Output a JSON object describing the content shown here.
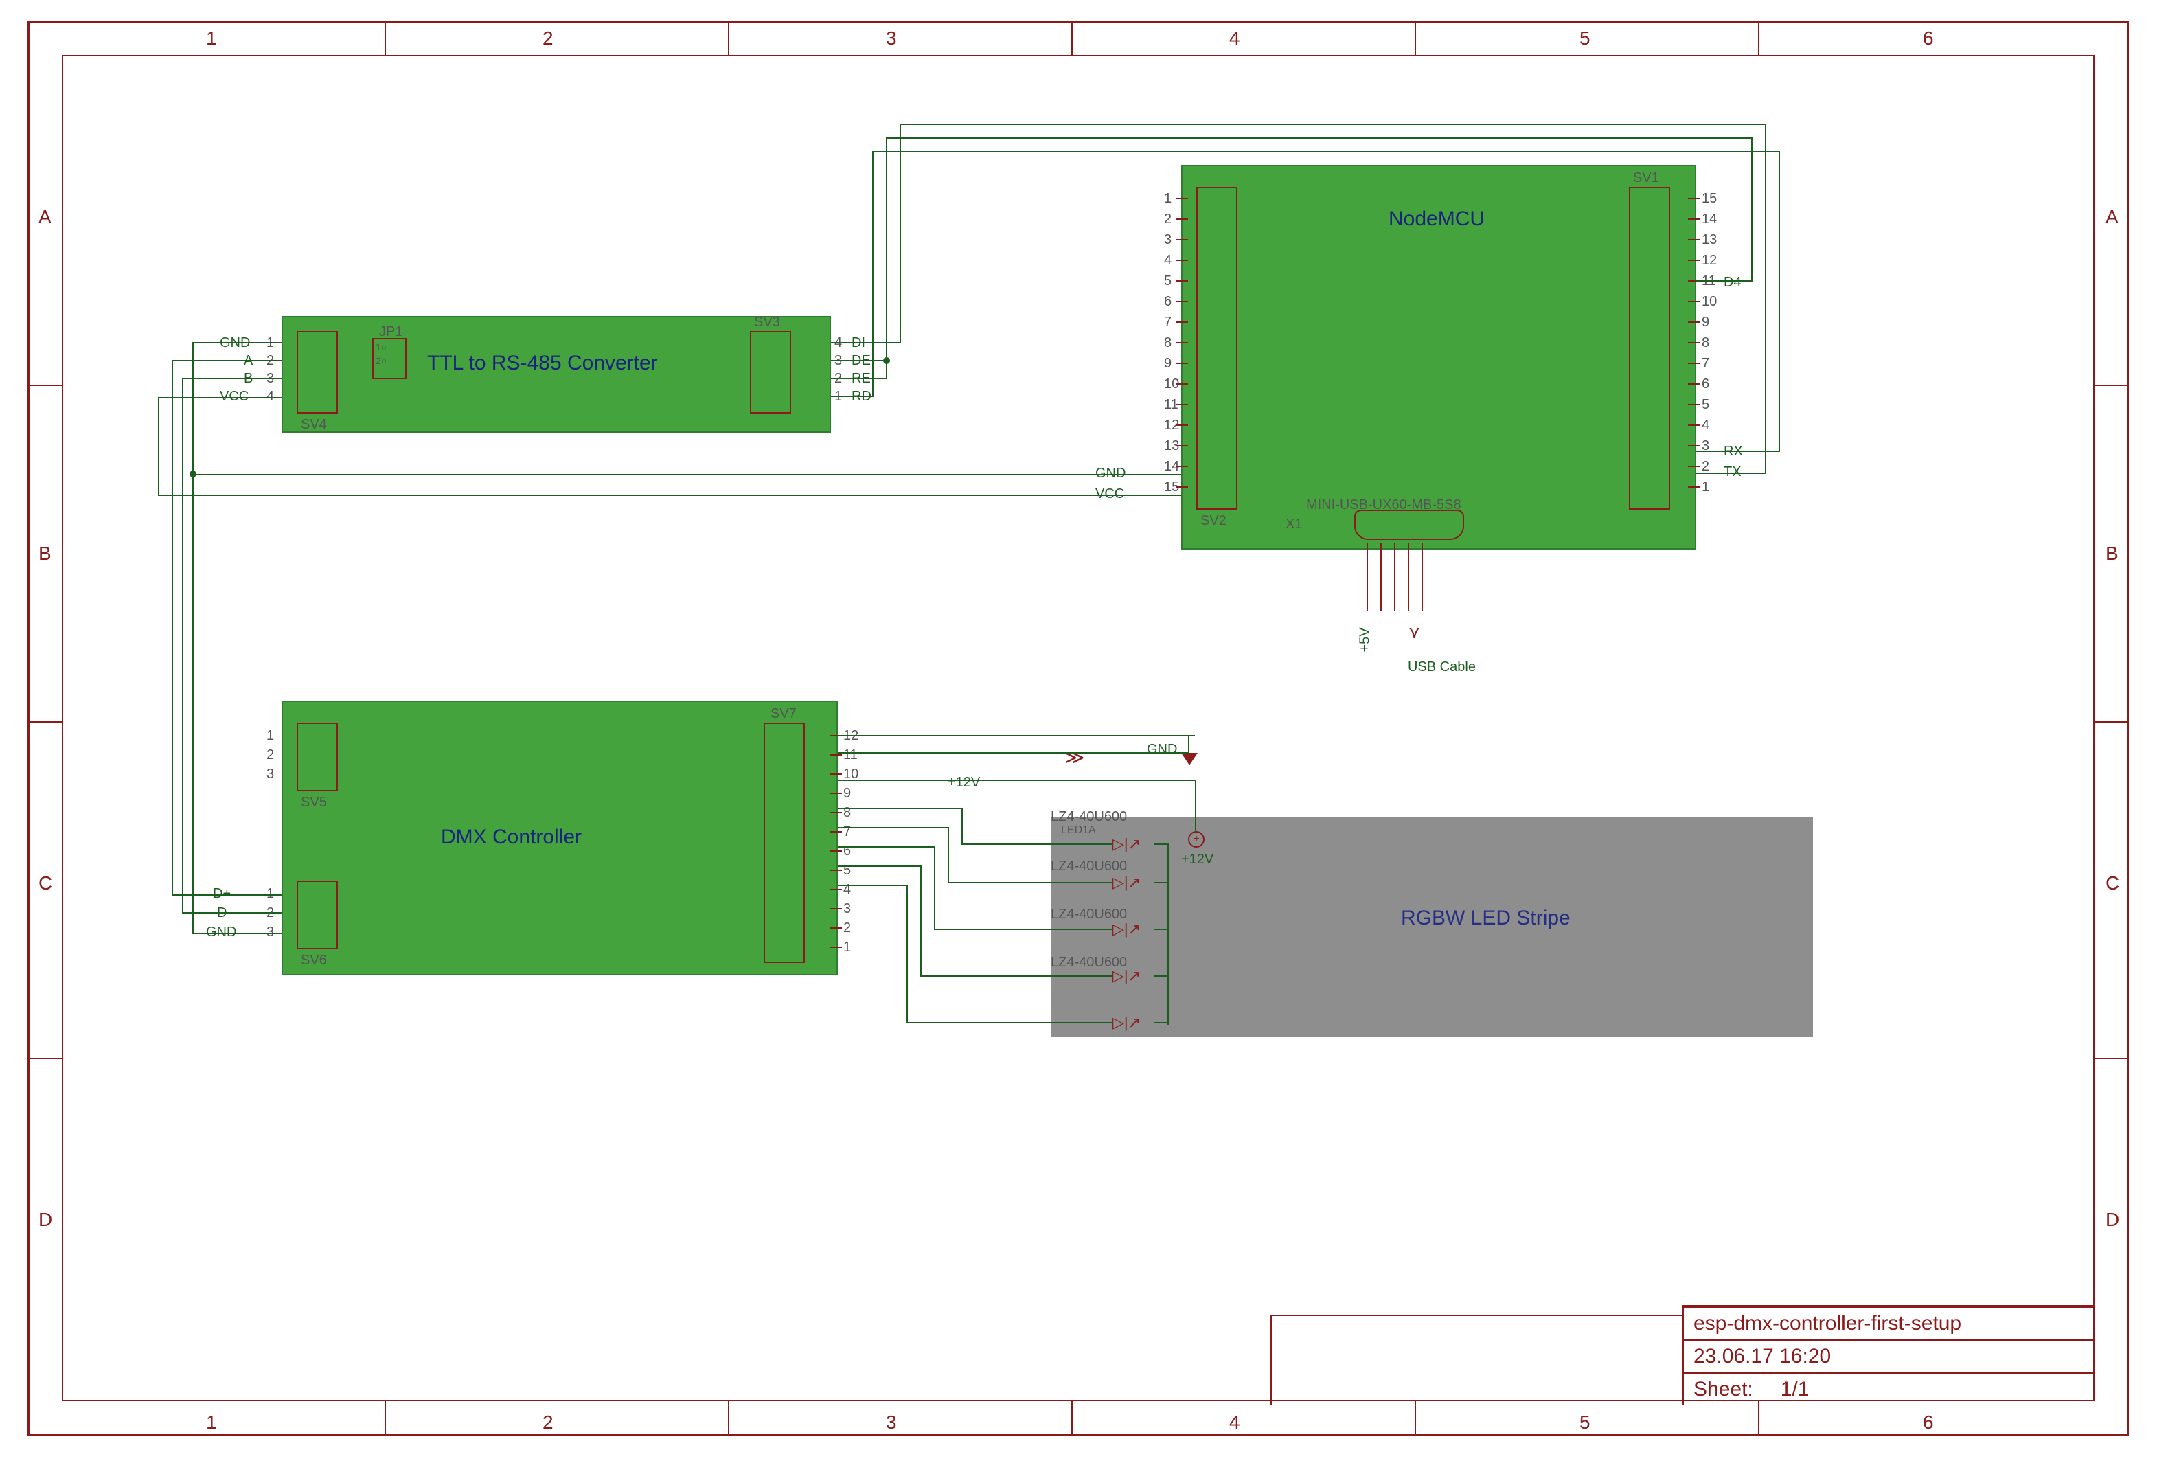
{
  "frame": {
    "cols": [
      "1",
      "2",
      "3",
      "4",
      "5",
      "6"
    ],
    "rows": [
      "A",
      "B",
      "C",
      "D"
    ]
  },
  "titleblock": {
    "project": "esp-dmx-controller-first-setup",
    "date": "23.06.17 16:20",
    "sheet_label": "Sheet:",
    "sheet_value": "1/1"
  },
  "blocks": {
    "ttl": {
      "label": "TTL to RS-485 Converter",
      "left_header_ref": "SV4",
      "right_header_ref": "SV3",
      "left_pins": [
        {
          "num": "1",
          "name": "GND"
        },
        {
          "num": "2",
          "name": "A"
        },
        {
          "num": "3",
          "name": "B"
        },
        {
          "num": "4",
          "name": "VCC"
        }
      ],
      "right_pins": [
        {
          "num": "4",
          "name": "DI"
        },
        {
          "num": "3",
          "name": "DE"
        },
        {
          "num": "2",
          "name": "RE"
        },
        {
          "num": "1",
          "name": "RD"
        }
      ],
      "jp": {
        "ref": "JP1",
        "opts": "1\n2"
      }
    },
    "nodemcu": {
      "label": "NodeMCU",
      "left_header_ref": "SV2",
      "right_header_ref": "SV1",
      "usb_label": "MINI-USB-UX60-MB-5S8",
      "usb_part_ref": "X1",
      "usb_cable_label": "USB Cable",
      "usb_plus5v": "+5V",
      "left_pins": [
        "1",
        "2",
        "3",
        "4",
        "5",
        "6",
        "7",
        "8",
        "9",
        "10",
        "11",
        "12",
        "13",
        "14",
        "15"
      ],
      "right_pins": [
        "15",
        "14",
        "13",
        "12",
        "11",
        "10",
        "9",
        "8",
        "7",
        "6",
        "5",
        "4",
        "3",
        "2",
        "1"
      ],
      "left_extra": [
        {
          "num": "14",
          "name": "GND"
        },
        {
          "num": "15",
          "name": "VCC"
        }
      ],
      "right_extra": [
        {
          "num": "11",
          "name": "D4"
        },
        {
          "num": "2",
          "name": "RX"
        },
        {
          "num": "1",
          "name": "TX"
        }
      ]
    },
    "dmx": {
      "label": "DMX Controller",
      "top_header_ref": "SV5",
      "bottom_header_ref": "SV6",
      "right_header_ref": "SV7",
      "top_pins": [
        "1",
        "2",
        "3"
      ],
      "bottom_pins": [
        {
          "num": "1",
          "name": "D+"
        },
        {
          "num": "2",
          "name": "D-"
        },
        {
          "num": "3",
          "name": "GND"
        }
      ],
      "right_pins": [
        "12",
        "11",
        "10",
        "9",
        "8",
        "7",
        "6",
        "5",
        "4",
        "3",
        "2",
        "1"
      ]
    },
    "rgbw": {
      "label": "RGBW LED Stripe",
      "plus12v_label": "+12V",
      "gnd_label": "GND",
      "led_part": "LZ4-40U600",
      "led_ref": "LED1A",
      "leds": [
        "LZ4-40U600",
        "LZ4-40U600",
        "LZ4-40U600",
        "LZ4-40U600"
      ]
    }
  },
  "signals": {
    "plus12v": "+12V"
  }
}
